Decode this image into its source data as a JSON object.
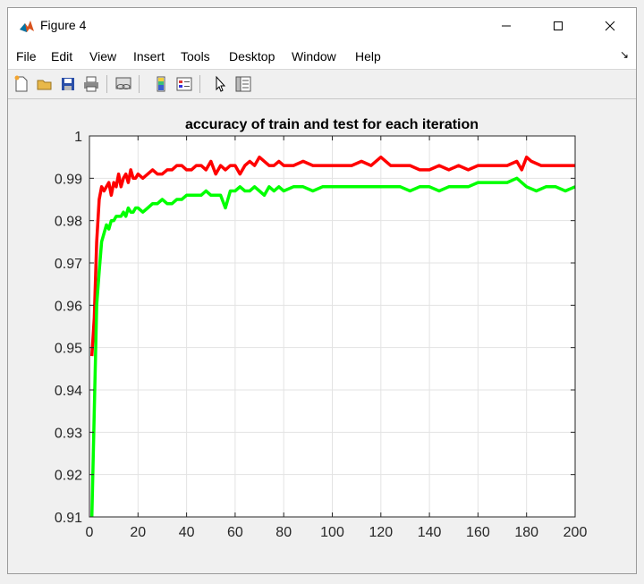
{
  "window": {
    "title": "Figure 4"
  },
  "menu": [
    "File",
    "Edit",
    "View",
    "Insert",
    "Tools",
    "Desktop",
    "Window",
    "Help"
  ],
  "toolbar": {
    "icons": [
      "new-figure-icon",
      "open-file-icon",
      "save-icon",
      "print-icon",
      "link-plot-icon",
      "insert-colorbar-icon",
      "insert-legend-icon",
      "edit-plot-icon",
      "property-inspector-icon"
    ]
  },
  "chart_data": {
    "type": "line",
    "title": "accuracy of train and test for each iteration",
    "xlabel": "",
    "ylabel": "",
    "xlim": [
      0,
      200
    ],
    "ylim": [
      0.91,
      1
    ],
    "xticks": [
      0,
      20,
      40,
      60,
      80,
      100,
      120,
      140,
      160,
      180,
      200
    ],
    "yticks": [
      0.91,
      0.92,
      0.93,
      0.94,
      0.95,
      0.96,
      0.97,
      0.98,
      0.99,
      1
    ],
    "ytick_labels": [
      "0.91",
      "0.92",
      "0.93",
      "0.94",
      "0.95",
      "0.96",
      "0.97",
      "0.98",
      "0.99",
      "1"
    ],
    "grid": true,
    "series": [
      {
        "color": "#ff0000",
        "x": [
          1,
          2,
          3,
          4,
          5,
          6,
          7,
          8,
          9,
          10,
          11,
          12,
          13,
          14,
          15,
          16,
          17,
          18,
          19,
          20,
          22,
          24,
          26,
          28,
          30,
          32,
          34,
          36,
          38,
          40,
          42,
          44,
          46,
          48,
          50,
          52,
          54,
          56,
          58,
          60,
          62,
          64,
          66,
          68,
          70,
          72,
          74,
          76,
          78,
          80,
          84,
          88,
          92,
          96,
          100,
          104,
          108,
          112,
          116,
          120,
          124,
          128,
          132,
          136,
          140,
          144,
          148,
          152,
          156,
          160,
          164,
          168,
          172,
          176,
          178,
          180,
          182,
          186,
          190,
          194,
          198,
          200
        ],
        "values": [
          0.948,
          0.957,
          0.975,
          0.985,
          0.988,
          0.987,
          0.988,
          0.989,
          0.986,
          0.989,
          0.988,
          0.991,
          0.988,
          0.99,
          0.991,
          0.989,
          0.992,
          0.99,
          0.99,
          0.991,
          0.99,
          0.991,
          0.992,
          0.991,
          0.991,
          0.992,
          0.992,
          0.993,
          0.993,
          0.992,
          0.992,
          0.993,
          0.993,
          0.992,
          0.994,
          0.991,
          0.993,
          0.992,
          0.993,
          0.993,
          0.991,
          0.993,
          0.994,
          0.993,
          0.995,
          0.994,
          0.993,
          0.993,
          0.994,
          0.993,
          0.993,
          0.994,
          0.993,
          0.993,
          0.993,
          0.993,
          0.993,
          0.994,
          0.993,
          0.995,
          0.993,
          0.993,
          0.993,
          0.992,
          0.992,
          0.993,
          0.992,
          0.993,
          0.992,
          0.993,
          0.993,
          0.993,
          0.993,
          0.994,
          0.992,
          0.995,
          0.994,
          0.993,
          0.993,
          0.993,
          0.993,
          0.993
        ]
      },
      {
        "color": "#00ff00",
        "x": [
          1,
          2,
          3,
          4,
          5,
          6,
          7,
          8,
          9,
          10,
          11,
          12,
          13,
          14,
          15,
          16,
          17,
          18,
          19,
          20,
          22,
          24,
          26,
          28,
          30,
          32,
          34,
          36,
          38,
          40,
          42,
          44,
          46,
          48,
          50,
          52,
          54,
          56,
          58,
          60,
          62,
          64,
          66,
          68,
          70,
          72,
          74,
          76,
          78,
          80,
          84,
          88,
          92,
          96,
          100,
          104,
          108,
          112,
          116,
          120,
          124,
          128,
          132,
          136,
          140,
          144,
          148,
          152,
          156,
          160,
          164,
          168,
          172,
          176,
          180,
          184,
          188,
          192,
          196,
          200
        ],
        "values": [
          0.91,
          0.935,
          0.96,
          0.968,
          0.975,
          0.977,
          0.979,
          0.978,
          0.98,
          0.98,
          0.981,
          0.981,
          0.981,
          0.982,
          0.981,
          0.983,
          0.982,
          0.982,
          0.983,
          0.983,
          0.982,
          0.983,
          0.984,
          0.984,
          0.985,
          0.984,
          0.984,
          0.985,
          0.985,
          0.986,
          0.986,
          0.986,
          0.986,
          0.987,
          0.986,
          0.986,
          0.986,
          0.983,
          0.987,
          0.987,
          0.988,
          0.987,
          0.987,
          0.988,
          0.987,
          0.986,
          0.988,
          0.987,
          0.988,
          0.987,
          0.988,
          0.988,
          0.987,
          0.988,
          0.988,
          0.988,
          0.988,
          0.988,
          0.988,
          0.988,
          0.988,
          0.988,
          0.987,
          0.988,
          0.988,
          0.987,
          0.988,
          0.988,
          0.988,
          0.989,
          0.989,
          0.989,
          0.989,
          0.99,
          0.988,
          0.987,
          0.988,
          0.988,
          0.987,
          0.988
        ]
      }
    ]
  }
}
